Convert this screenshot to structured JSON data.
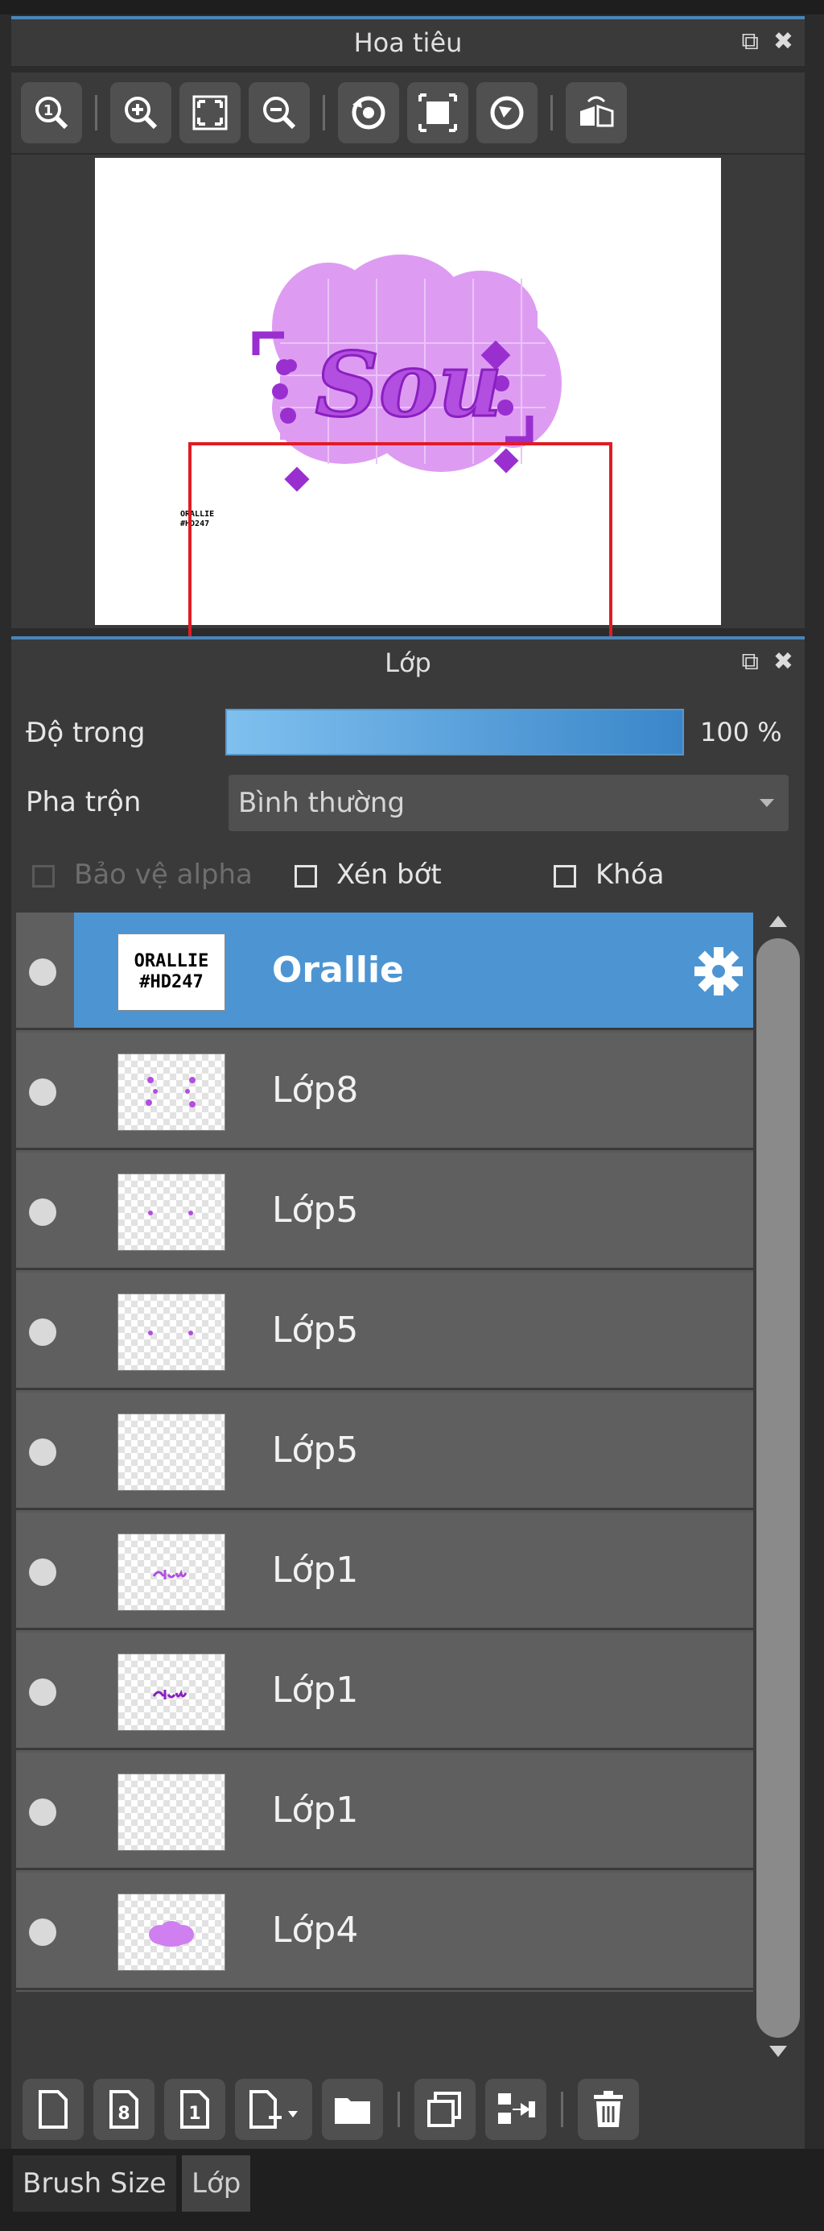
{
  "navigator": {
    "title": "Hoa tiêu",
    "tools": [
      {
        "icon": "zoom-actual-icon"
      },
      {
        "icon": "zoom-in-icon"
      },
      {
        "icon": "fit-to-window-icon"
      },
      {
        "icon": "zoom-out-icon"
      },
      {
        "icon": "rotate-left-icon"
      },
      {
        "icon": "reset-view-icon"
      },
      {
        "icon": "rotate-right-icon"
      },
      {
        "icon": "flip-horizontal-icon"
      }
    ],
    "preview": {
      "signature_line1": "ORALLIE",
      "signature_line2": "#HD247"
    }
  },
  "layers_panel": {
    "title": "Lớp",
    "opacity_label": "Độ trong",
    "opacity_value": "100 %",
    "opacity_fraction": 1.0,
    "blend_label": "Pha trộn",
    "blend_value": "Bình thường",
    "protect_alpha": "Bảo vệ alpha",
    "clipping": "Xén bớt",
    "lock": "Khóa",
    "layers": [
      {
        "name": "Orallie",
        "selected": true,
        "thumb_line1": "ORALLIE",
        "thumb_line2": "#HD247"
      },
      {
        "name": "Lớp8"
      },
      {
        "name": "Lớp5"
      },
      {
        "name": "Lớp5"
      },
      {
        "name": "Lớp5"
      },
      {
        "name": "Lớp1"
      },
      {
        "name": "Lớp1"
      },
      {
        "name": "Lớp1"
      },
      {
        "name": "Lớp4"
      }
    ],
    "bottom_tools": [
      {
        "icon": "new-layer-icon"
      },
      {
        "icon": "new-8bit-layer-icon"
      },
      {
        "icon": "new-1bit-layer-icon"
      },
      {
        "icon": "add-layer-menu-icon"
      },
      {
        "icon": "new-folder-icon"
      },
      {
        "icon": "duplicate-layer-icon"
      },
      {
        "icon": "merge-down-icon"
      },
      {
        "icon": "delete-layer-icon"
      }
    ]
  },
  "tabs": [
    "Brush Size",
    "Lớp"
  ],
  "colors": {
    "selected_row": "#4d95d2",
    "accent": "#4a86b8",
    "frame": "#e01c24",
    "purple": "#b24ee0"
  }
}
